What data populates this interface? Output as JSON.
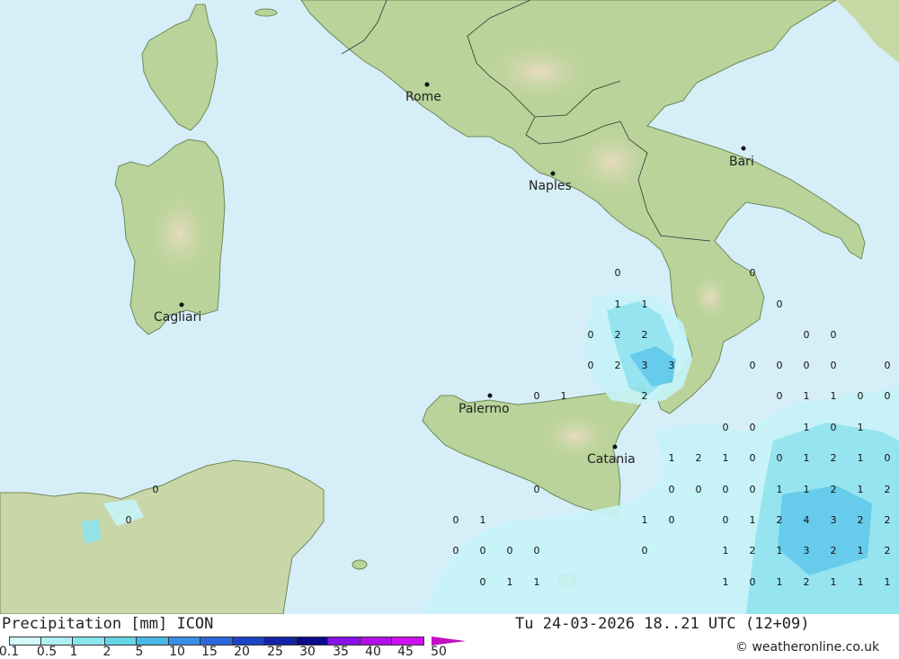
{
  "header": {
    "title": "Precipitation [mm] ICON",
    "valid_time": "Tu 24-03-2026 18..21 UTC (12+09)",
    "credit": "© weatheronline.co.uk"
  },
  "legend": {
    "ticks": [
      "0.1",
      "0.5",
      "1",
      "2",
      "5",
      "10",
      "15",
      "20",
      "25",
      "30",
      "35",
      "40",
      "45",
      "50"
    ],
    "colors": [
      "#d2f8fa",
      "#aff0f4",
      "#8ae6ee",
      "#64d6e6",
      "#4ab8e6",
      "#3a90e6",
      "#2a68dc",
      "#1c44c4",
      "#1424a8",
      "#0a0a8c",
      "#8a10e8",
      "#b010e8",
      "#d010f0",
      "#e010e0",
      "#c010c0"
    ]
  },
  "cities": [
    {
      "name": "Rome"
    },
    {
      "name": "Naples"
    },
    {
      "name": "Bari"
    },
    {
      "name": "Cagliari"
    },
    {
      "name": "Palermo"
    },
    {
      "name": "Catania"
    }
  ],
  "grid_values": [
    "0",
    "0",
    "1",
    "1",
    "0",
    "0",
    "2",
    "2",
    "0",
    "0",
    "0",
    "2",
    "3",
    "3",
    "0",
    "0",
    "0",
    "0",
    "0",
    "0",
    "1",
    "2",
    "0",
    "1",
    "1",
    "0",
    "0",
    "0",
    "0",
    "1",
    "0",
    "1",
    "1",
    "2",
    "1",
    "0",
    "0",
    "1",
    "2",
    "1",
    "0",
    "0",
    "0",
    "0",
    "0",
    "0",
    "1",
    "1",
    "2",
    "1",
    "2",
    "0",
    "0",
    "1",
    "0",
    "1",
    "0",
    "0",
    "1",
    "2",
    "4",
    "3",
    "2",
    "2",
    "0",
    "0",
    "0",
    "0",
    "0",
    "1",
    "2",
    "1",
    "3",
    "2",
    "1",
    "2",
    "0",
    "1",
    "1",
    "1",
    "0",
    "1",
    "2",
    "1",
    "1",
    "1"
  ],
  "colors": {
    "sea": "#d6eef8",
    "land": "#b9d39a",
    "precip_light": "#c6f4f8",
    "precip_mid": "#8ee4f0",
    "precip_heavy": "#5cc8ea"
  }
}
